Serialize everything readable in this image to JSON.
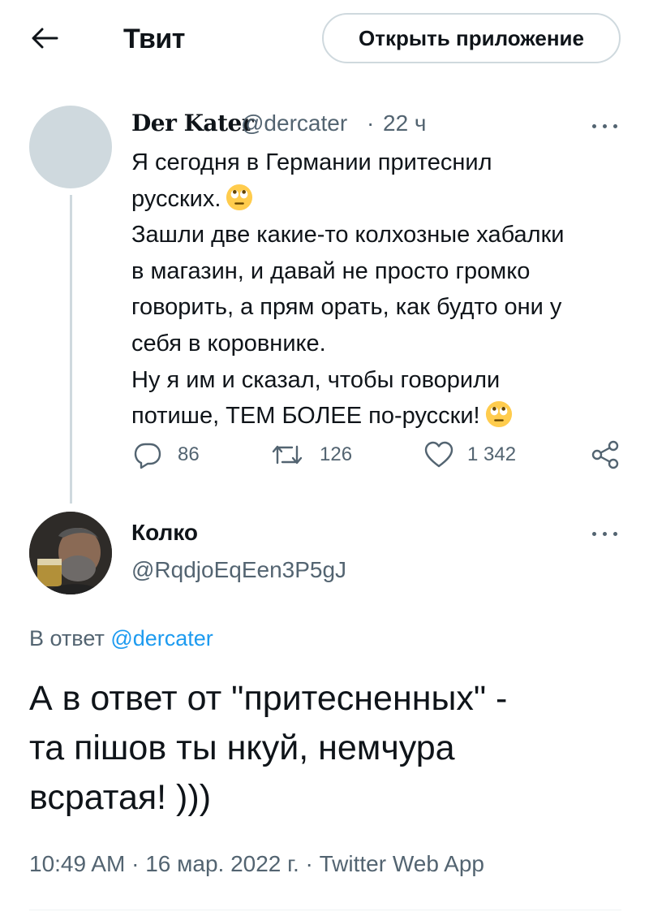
{
  "header": {
    "title": "Твит",
    "open_app_label": "Открыть приложение"
  },
  "parent_tweet": {
    "author_name": "Der Kater",
    "author_handle": "@dercater",
    "separator": "·",
    "time": "22 ч",
    "text_lines": [
      "Я сегодня в Германии притеснил",
      "русских.",
      "Зашли две какие-то колхозные хабалки",
      "в магазин, и давай не просто громко",
      "говорить, а прям орать, как будто они у",
      "себя в коровнике.",
      "Ну я им и сказал, чтобы говорили",
      "потише, ТЕМ БОЛЕЕ по-русски!"
    ],
    "emoji": "face-with-rolling-eyes",
    "replies": "86",
    "retweets": "126",
    "likes": "1 342"
  },
  "reply": {
    "author_name": "Колко",
    "author_handle": "@RqdjoEqEen3P5gJ",
    "reply_prefix": "В ответ",
    "reply_to_handle": "@dercater",
    "text_lines": [
      "А в ответ от \"притесненных\" -",
      "та пішов ты нкуй, немчура",
      "всратая! )))"
    ],
    "time": "10:49 AM",
    "date": "16 мар. 2022 г.",
    "separator": "·",
    "source": "Twitter Web App"
  },
  "colors": {
    "accent": "#1d9bf0",
    "secondary_text": "#536471",
    "border": "#cfd9de"
  }
}
